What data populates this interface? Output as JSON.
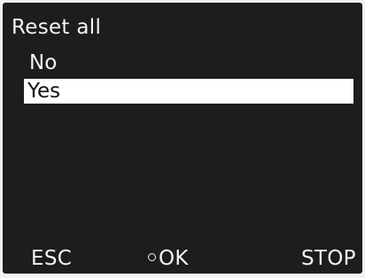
{
  "screen": {
    "title": "Reset all",
    "options": [
      {
        "label": "No",
        "selected": false
      },
      {
        "label": "Yes",
        "selected": true
      }
    ]
  },
  "softkeys": {
    "left": "ESC",
    "center": "OK",
    "center_icon": "circle-icon",
    "right": "STOP"
  },
  "colors": {
    "screen_bg": "#1d1d1d",
    "text": "#f4f4f4",
    "highlight_bg": "#ffffff",
    "highlight_text": "#111111"
  }
}
